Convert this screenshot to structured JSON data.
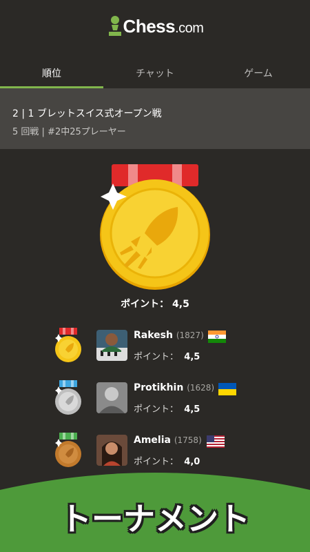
{
  "app": {
    "brand": "Chess",
    "brand_domain": ".com"
  },
  "tabs": [
    {
      "label": "順位",
      "active": true
    },
    {
      "label": "チャット",
      "active": false
    },
    {
      "label": "ゲーム",
      "active": false
    }
  ],
  "tournament": {
    "title": "2 | 1 ブレットスイス式オープン戦",
    "subtitle": "5 回戦 | #2中25プレーヤー"
  },
  "summary": {
    "points_text": "ポイント： 4,5"
  },
  "standings": [
    {
      "name": "Rakesh",
      "rating": "(1827)",
      "points_label": "ポイント：",
      "points": "4,5",
      "medal": "gold",
      "flag": "india-flag"
    },
    {
      "name": "Protikhin",
      "rating": "(1628)",
      "points_label": "ポイント：",
      "points": "4,5",
      "medal": "silver",
      "flag": "ukraine-flag"
    },
    {
      "name": "Amelia",
      "rating": "(1758)",
      "points_label": "ポイント：",
      "points": "4,0",
      "medal": "bronze",
      "flag": "usa-flag"
    }
  ],
  "banner": {
    "text": "トーナメント"
  },
  "colors": {
    "accent_green": "#81b64c",
    "background": "#2b2926",
    "info_bar": "#474542",
    "gold": "#f5c518",
    "ribbon_red": "#e02a2a"
  }
}
